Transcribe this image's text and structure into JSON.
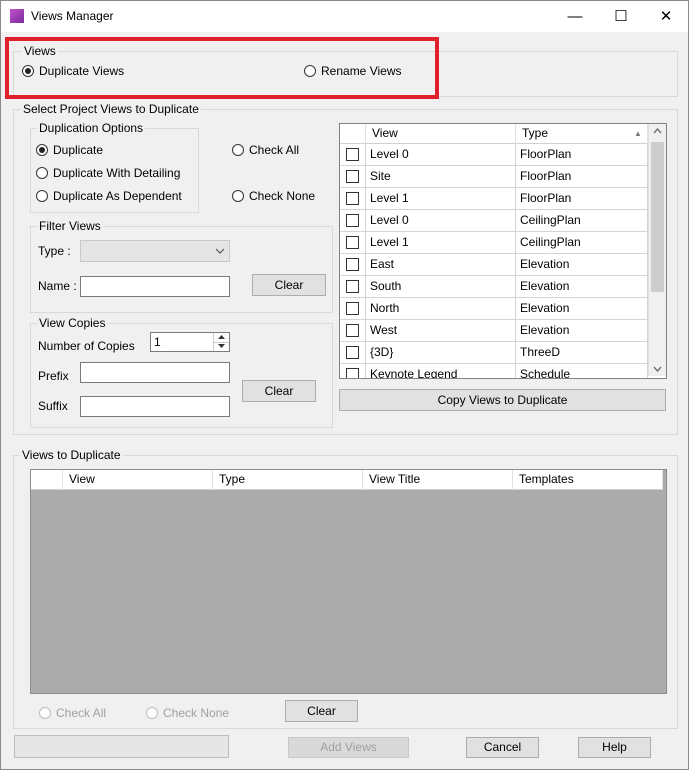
{
  "window": {
    "title": "Views Manager",
    "minimize_glyph": "—",
    "maximize_glyph": "☐",
    "close_glyph": "✕"
  },
  "views_group": {
    "label": "Views",
    "duplicate_label": "Duplicate Views",
    "rename_label": "Rename Views",
    "selected": "Duplicate Views"
  },
  "select_group": {
    "label": "Select Project Views to Duplicate",
    "duplication_options": {
      "label": "Duplication Options",
      "options": [
        "Duplicate",
        "Duplicate With Detailing",
        "Duplicate As Dependent"
      ],
      "selected": "Duplicate"
    },
    "check_all_label": "Check All",
    "check_none_label": "Check None",
    "filter": {
      "label": "Filter Views",
      "type_label": "Type :",
      "type_value": "",
      "name_label": "Name :",
      "name_value": "",
      "clear_label": "Clear"
    },
    "copies": {
      "label": "View Copies",
      "number_label": "Number of Copies",
      "number_value": "1",
      "prefix_label": "Prefix",
      "prefix_value": "",
      "suffix_label": "Suffix",
      "suffix_value": "",
      "clear_label": "Clear"
    },
    "grid": {
      "columns": [
        "View",
        "Type"
      ],
      "sort_glyph": "▲",
      "rows": [
        {
          "view": "Level 0",
          "type": "FloorPlan"
        },
        {
          "view": "Site",
          "type": "FloorPlan"
        },
        {
          "view": "Level 1",
          "type": "FloorPlan"
        },
        {
          "view": "Level 0",
          "type": "CeilingPlan"
        },
        {
          "view": "Level 1",
          "type": "CeilingPlan"
        },
        {
          "view": "East",
          "type": "Elevation"
        },
        {
          "view": "South",
          "type": "Elevation"
        },
        {
          "view": "North",
          "type": "Elevation"
        },
        {
          "view": "West",
          "type": "Elevation"
        },
        {
          "view": "{3D}",
          "type": "ThreeD"
        },
        {
          "view": "Keynote Legend",
          "type": "Schedule"
        }
      ]
    },
    "copy_button_label": "Copy Views to Duplicate"
  },
  "duplicate_group": {
    "label": "Views to Duplicate",
    "columns": [
      "View",
      "Type",
      "View Title",
      "Templates"
    ],
    "check_all_label": "Check All",
    "check_none_label": "Check None",
    "clear_label": "Clear"
  },
  "footer": {
    "status_text": "",
    "add_views_label": "Add Views",
    "cancel_label": "Cancel",
    "help_label": "Help"
  },
  "colors": {
    "highlight_border": "#e0202a",
    "window_bg": "#f0f0f0",
    "empty_grid_bg": "#ababab"
  }
}
